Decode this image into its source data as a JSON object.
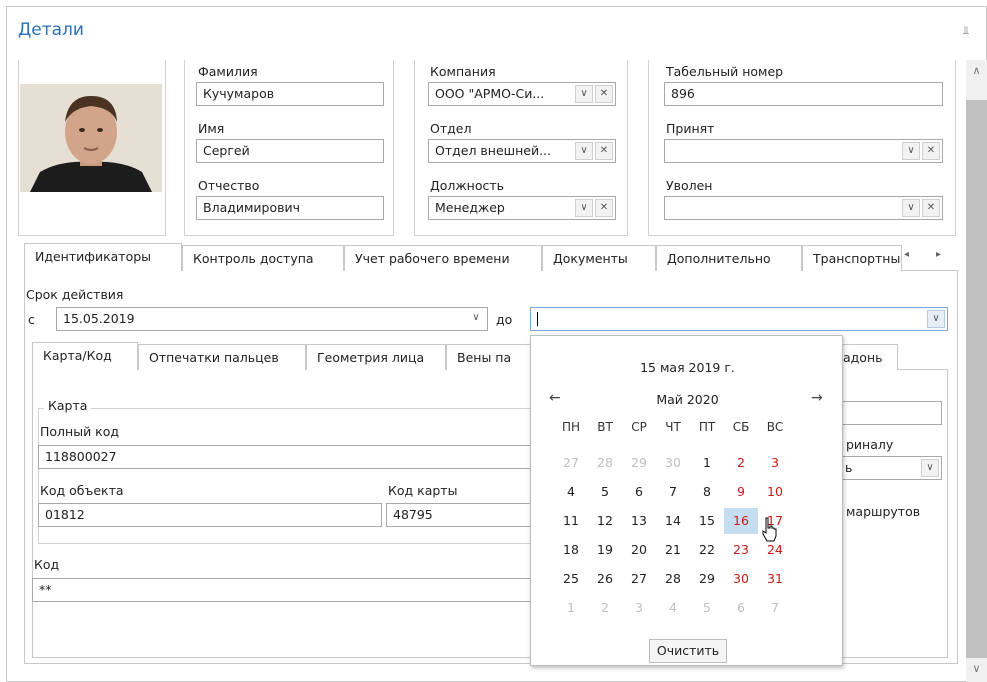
{
  "panel": {
    "title": "Детали"
  },
  "person": {
    "last_name_label": "Фамилия",
    "last_name": "Кучумаров",
    "first_name_label": "Имя",
    "first_name": "Сергей",
    "middle_name_label": "Отчество",
    "middle_name": "Владимирович"
  },
  "org": {
    "company_label": "Компания",
    "company": "ООО \"АРМО-Си...",
    "department_label": "Отдел",
    "department": "Отдел внешней...",
    "position_label": "Должность",
    "position": "Менеджер"
  },
  "hr": {
    "tab_number_label": "Табельный номер",
    "tab_number": "896",
    "hired_label": "Принят",
    "hired": "",
    "fired_label": "Уволен",
    "fired": ""
  },
  "tabs": [
    "Идентификаторы",
    "Контроль доступа",
    "Учет рабочего времени",
    "Документы",
    "Дополнительно",
    "Транспортны"
  ],
  "validity": {
    "label": "Срок действия",
    "from_label": "с",
    "from": "15.05.2019",
    "to_label": "до",
    "to": ""
  },
  "subtabs": [
    "Карта/Код",
    "Отпечатки пальцев",
    "Геометрия лица",
    "Вены па",
    "адонь"
  ],
  "card": {
    "group_label": "Карта",
    "full_code_label": "Полный код",
    "full_code": "118800027",
    "object_code_label": "Код объекта",
    "object_code": "01812",
    "card_code_label": "Код карты",
    "card_code": "48795",
    "code_label": "Код",
    "code": "**"
  },
  "right_side": {
    "original_label": "риналу",
    "combo_value": "ь",
    "routes_label": "маршрутов"
  },
  "calendar": {
    "today": "15 мая 2019 г.",
    "month": "Май 2020",
    "weekdays": [
      "ПН",
      "ВТ",
      "СР",
      "ЧТ",
      "ПТ",
      "СБ",
      "ВС"
    ],
    "weeks": [
      [
        "27",
        "28",
        "29",
        "30",
        "1",
        "2",
        "3"
      ],
      [
        "4",
        "5",
        "6",
        "7",
        "8",
        "9",
        "10"
      ],
      [
        "11",
        "12",
        "13",
        "14",
        "15",
        "16",
        "17"
      ],
      [
        "18",
        "19",
        "20",
        "21",
        "22",
        "23",
        "24"
      ],
      [
        "25",
        "26",
        "27",
        "28",
        "29",
        "30",
        "31"
      ],
      [
        "1",
        "2",
        "3",
        "4",
        "5",
        "6",
        "7"
      ]
    ],
    "selected_day": "16",
    "clear_label": "Очистить"
  },
  "colors": {
    "title": "#2a6fb8",
    "weekend": "#d01818",
    "selected": "#c5ddf0"
  }
}
